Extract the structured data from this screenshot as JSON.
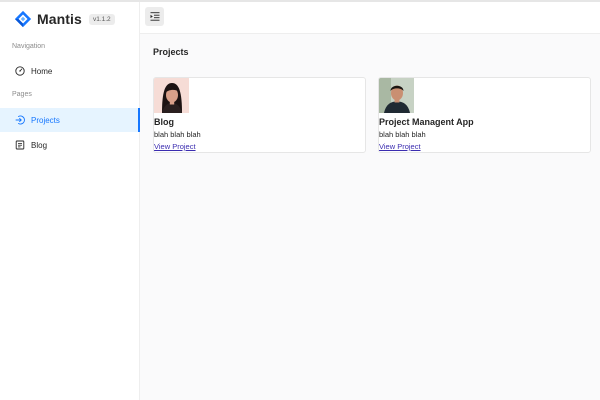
{
  "brand": {
    "name": "Mantis",
    "version": "v1.1.2",
    "logo_icon": "diamond-logo-icon",
    "accent": "#1677ff"
  },
  "sidebar": {
    "sections": [
      {
        "label": "Navigation",
        "items": [
          {
            "label": "Home",
            "icon": "dashboard-icon",
            "active": false
          }
        ]
      },
      {
        "label": "Pages",
        "items": [
          {
            "label": "Projects",
            "icon": "login-icon",
            "active": true
          },
          {
            "label": "Blog",
            "icon": "profile-icon",
            "active": false
          }
        ]
      }
    ]
  },
  "header": {
    "toggle_icon": "menu-fold-icon"
  },
  "main": {
    "title": "Projects",
    "projects": [
      {
        "title": "Blog",
        "description": "blah blah blah",
        "link_label": "View Project",
        "image": "woman-portrait-photo"
      },
      {
        "title": "Project Managent App",
        "description": "blah blah blah",
        "link_label": "View Project",
        "image": "man-portrait-photo"
      }
    ]
  }
}
